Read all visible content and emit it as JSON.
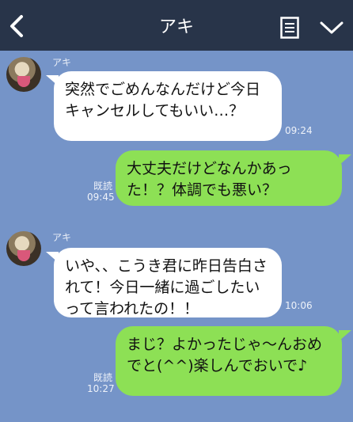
{
  "header": {
    "title": "アキ",
    "colors": {
      "bar": "#283449",
      "background": "#7594c8"
    },
    "icons": {
      "back": "chevron-left-icon",
      "menu": "note-icon",
      "more": "chevron-down-icon"
    }
  },
  "messages": [
    {
      "side": "left",
      "sender": "アキ",
      "text": "突然でごめんなんだけど今日キャンセルしてもいい…？",
      "time": "09:24"
    },
    {
      "side": "right",
      "read": "既読",
      "text": "大丈夫だけどなんかあった！？体調でも悪い？",
      "time": "09:45"
    },
    {
      "side": "left",
      "sender": "アキ",
      "text": "いや、、こうき君に昨日告白されて！今日一緒に過ごしたいって言われたの！！",
      "time": "10:06"
    },
    {
      "side": "right",
      "read": "既読",
      "text": "まじ？よかったじゃ～んおめでと(^^)楽しんでおいで♪",
      "time": "10:27"
    }
  ],
  "colors": {
    "incoming_bubble": "#ffffff",
    "outgoing_bubble": "#8de055"
  }
}
